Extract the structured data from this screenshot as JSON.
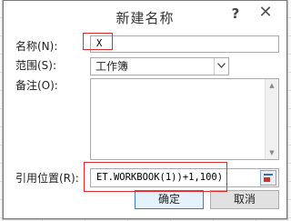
{
  "dialog": {
    "title": "新建名称",
    "help_symbol": "?",
    "close_symbol": "✕"
  },
  "form": {
    "name_label": "名称(N):",
    "name_value": "X",
    "scope_label": "范围(S):",
    "scope_value": "工作簿",
    "comment_label": "备注(O):",
    "comment_value": "",
    "refers_label": "引用位置(R):",
    "refers_value": "ET.WORKBOOK(1))+1,100)"
  },
  "buttons": {
    "ok_label": "确定",
    "cancel_label": "取消"
  },
  "icons": {
    "dropdown": "chevron-down-icon",
    "scroll_up": "triangle-up-icon",
    "scroll_down": "triangle-down-icon",
    "collapse": "collapse-dialog-icon"
  },
  "annotations": {
    "highlight_color": "#e02b2b"
  }
}
